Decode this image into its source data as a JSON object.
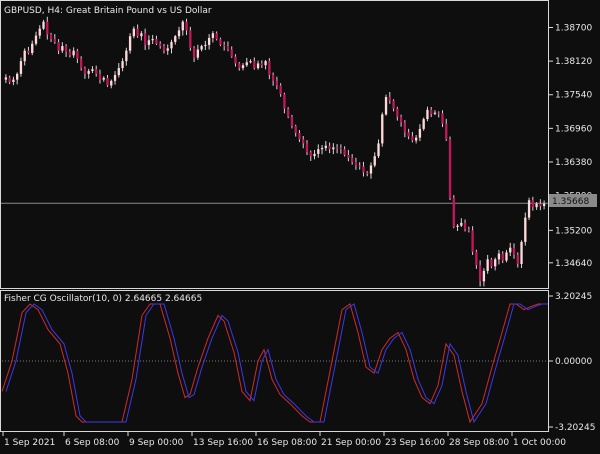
{
  "price_panel": {
    "symbol_label": "GBPUSD, H4:  Great Britain Pound vs US Dollar",
    "y_ticks": [
      "1.38700",
      "1.38120",
      "1.37540",
      "1.36960",
      "1.36380",
      "1.35800",
      "1.35200",
      "1.34640"
    ],
    "current_price_label": "1.35668"
  },
  "indicator_panel": {
    "label": "Fisher CG Oscillator(10, 0) 2.64665 2.64665",
    "y_ticks": [
      "3.20245",
      "0.00000",
      "-3.20245"
    ]
  },
  "time_axis": {
    "labels": [
      "1 Sep 2021",
      "6 Sep 08:00",
      "9 Sep 00:00",
      "13 Sep 16:00",
      "16 Sep 08:00",
      "21 Sep 00:00",
      "23 Sep 16:00",
      "28 Sep 08:00",
      "1 Oct 00:00"
    ]
  },
  "colors": {
    "background": "#0e0e0e",
    "border": "#d9d9d9",
    "text": "#e8e8e8",
    "bull_candle": "#ffd8d8",
    "bear_candle": "#c2185b",
    "wick": "#d6d6d6",
    "osc_line": "#d22a2a",
    "signal_line": "#3a3ae8",
    "price_line": "#8a8a8a",
    "price_label_bg": "#8a8a8a",
    "zero_line": "#7a7a7a"
  },
  "chart_data": {
    "type": "candlestick",
    "title": "GBPUSD, H4:  Great Britain Pound vs US Dollar",
    "ylim": [
      1.3424,
      1.3914
    ],
    "current_price": 1.35668,
    "close": [
      1.3784,
      1.3776,
      1.378,
      1.379,
      1.3812,
      1.383,
      1.3826,
      1.3842,
      1.3856,
      1.3868,
      1.388,
      1.3858,
      1.385,
      1.3845,
      1.383,
      1.3838,
      1.3828,
      1.3822,
      1.383,
      1.3816,
      1.38,
      1.379,
      1.3795,
      1.3798,
      1.379,
      1.378,
      1.3783,
      1.377,
      1.3778,
      1.3788,
      1.38,
      1.3812,
      1.383,
      1.3855,
      1.3868,
      1.3855,
      1.386,
      1.384,
      1.3848,
      1.385,
      1.3842,
      1.3838,
      1.383,
      1.3834,
      1.3845,
      1.3855,
      1.3865,
      1.388,
      1.3865,
      1.3835,
      1.3818,
      1.3832,
      1.3838,
      1.384,
      1.3852,
      1.386,
      1.385,
      1.384,
      1.3838,
      1.3832,
      1.382,
      1.3808,
      1.38,
      1.3805,
      1.381,
      1.3812,
      1.38,
      1.3808,
      1.3805,
      1.3812,
      1.3788,
      1.3778,
      1.377,
      1.3755,
      1.373,
      1.3716,
      1.37,
      1.3688,
      1.3677,
      1.367,
      1.3655,
      1.3648,
      1.3652,
      1.366,
      1.3662,
      1.3666,
      1.366,
      1.3663,
      1.3662,
      1.366,
      1.365,
      1.3645,
      1.3638,
      1.3632,
      1.363,
      1.362,
      1.3618,
      1.3632,
      1.3648,
      1.367,
      1.372,
      1.375,
      1.3744,
      1.373,
      1.3716,
      1.3706,
      1.3689,
      1.3682,
      1.3675,
      1.368,
      1.3695,
      1.3712,
      1.3728,
      1.3721,
      1.3723,
      1.3722,
      1.3704,
      1.3677,
      1.3576,
      1.3526,
      1.3528,
      1.3533,
      1.3522,
      1.352,
      1.3483,
      1.346,
      1.3432,
      1.345,
      1.347,
      1.3458,
      1.347,
      1.348,
      1.3468,
      1.3482,
      1.349,
      1.3478,
      1.3462,
      1.35,
      1.3542,
      1.3572,
      1.356,
      1.3566,
      1.3562,
      1.3566
    ]
  }
}
